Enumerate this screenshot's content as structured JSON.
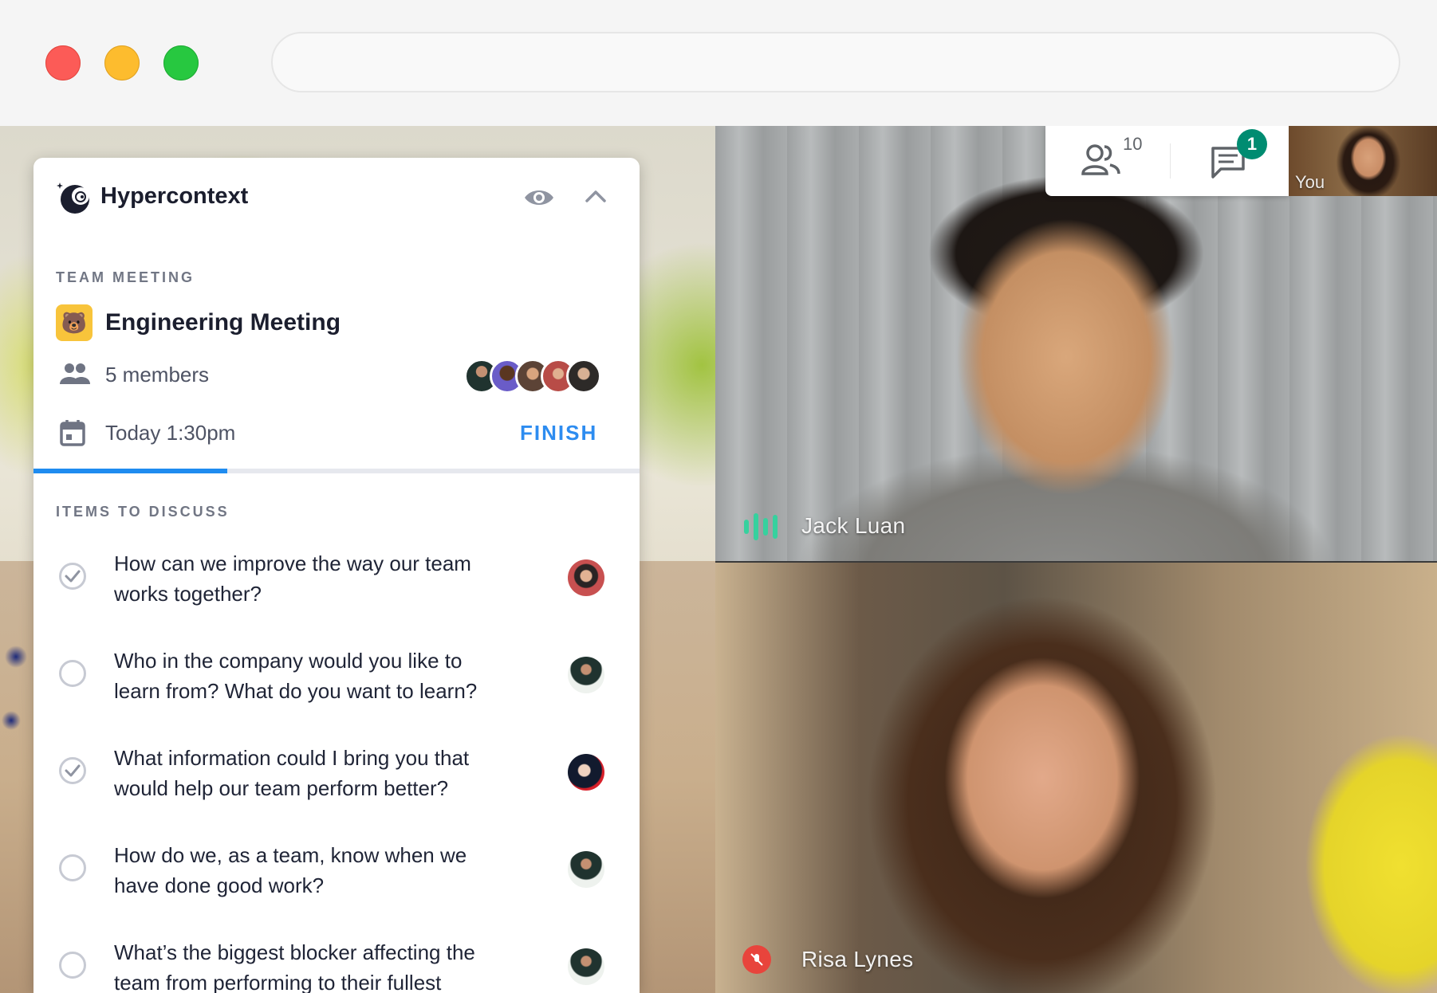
{
  "browser": {
    "url": ""
  },
  "panel": {
    "app_name": "Hypercontext",
    "eye_icon": "eye-icon",
    "collapse_icon": "chevron-up-icon",
    "section_label": "TEAM MEETING",
    "meeting_emoji": "🐻",
    "meeting_title": "Engineering Meeting",
    "members_text": "5 members",
    "time_text": "Today 1:30pm",
    "finish_label": "FINISH",
    "progress": 0.32,
    "items_label": "ITEMS TO DISCUSS",
    "items": [
      {
        "text": "How can we improve the way our team works together?",
        "done": true
      },
      {
        "text": "Who in the company would you like to learn from? What do you want to learn?",
        "done": false
      },
      {
        "text": "What information could I bring you that would help our team perform better?",
        "done": true
      },
      {
        "text": "How do we, as a team, know when we have done good work?",
        "done": false
      },
      {
        "text": "What’s the biggest blocker affecting the team from performing to their fullest",
        "done": false
      }
    ]
  },
  "meet": {
    "participants_count": "10",
    "chat_badge": "1",
    "self_label": "You",
    "tiles": [
      {
        "name": "Jack Luan",
        "status": "speaking"
      },
      {
        "name": "Risa Lynes",
        "status": "muted"
      }
    ],
    "accent_color": "#008c71",
    "speaking_color": "#36d19e"
  },
  "colors": {
    "finish": "#2d8cf0",
    "progress": "#1f8cf0",
    "meeting_emoji_bg": "#f8c43b"
  }
}
